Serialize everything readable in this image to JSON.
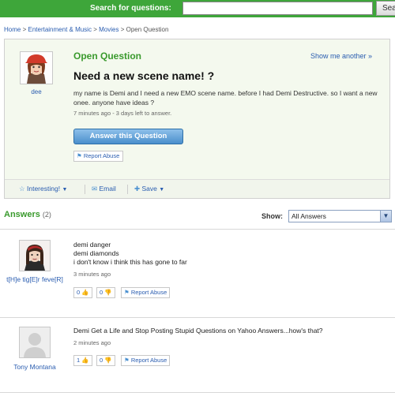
{
  "topbar": {
    "search_label": "Search for questions:",
    "search_placeholder": "",
    "search_button": "Sea"
  },
  "breadcrumb": [
    "Home",
    "Entertainment & Music",
    "Movies",
    "Open Question"
  ],
  "question": {
    "heading": "Open Question",
    "show_another": "Show me another »",
    "title": "Need a new scene name! ?",
    "body": "my name is Demi and I need a new EMO scene name. before I had Demi Destructive. so I want a new onee. anyone have ideas ?",
    "meta": "7 minutes ago - 3 days left to answer.",
    "asker": "dee",
    "answer_button": "Answer this Question",
    "report_abuse": "Report Abuse",
    "toolbar": {
      "interesting": "Interesting!",
      "email": "Email",
      "save": "Save"
    }
  },
  "answers": {
    "heading": "Answers",
    "count": "(2)",
    "show_label": "Show:",
    "show_value": "All Answers",
    "items": [
      {
        "author": "t[H]e tig[E]r feve[R]",
        "lines": [
          "demi danger",
          "demi diamonds",
          "i don't know i think this has gone to far"
        ],
        "meta": "3 minutes ago",
        "thumbs_up": "0",
        "thumbs_down": "0",
        "report": "Report Abuse"
      },
      {
        "author": "Tony Montana",
        "lines": [
          "Demi Get a Life and Stop Posting Stupid Questions on Yahoo Answers...how's that?"
        ],
        "meta": "2 minutes ago",
        "thumbs_up": "1",
        "thumbs_down": "0",
        "report": "Report Abuse"
      }
    ]
  },
  "colors": {
    "brand_green": "#3ea63a",
    "link_blue": "#2a5db0",
    "heading_green": "#3a9a2d"
  }
}
